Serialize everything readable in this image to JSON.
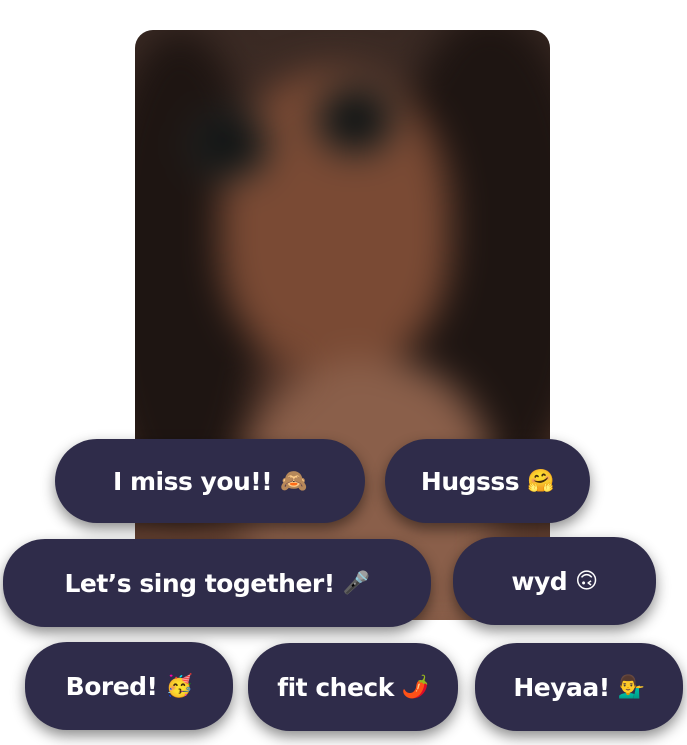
{
  "background_image": {
    "description": "blurred portrait photo of a person with dark hair and round sunglasses"
  },
  "chips": [
    {
      "label": "I miss you!!",
      "emoji": "🙈",
      "emoji_name": "see-no-evil-monkey-icon"
    },
    {
      "label": "Hugsss",
      "emoji": "🤗",
      "emoji_name": "hugging-face-icon"
    },
    {
      "label": "Let’s sing together!",
      "emoji": "🎤",
      "emoji_name": "microphone-icon"
    },
    {
      "label": "wyd",
      "emoji": "🙃",
      "emoji_name": "upside-down-face-icon"
    },
    {
      "label": "Bored!",
      "emoji": "🥳",
      "emoji_name": "partying-face-icon"
    },
    {
      "label": "fit check",
      "emoji": "🌶️",
      "emoji_name": "hot-pepper-icon"
    },
    {
      "label": "Heyaa!",
      "emoji": "💁‍♂️",
      "emoji_name": "person-tipping-hand-icon"
    }
  ],
  "colors": {
    "chip_background": "#2f2c4a",
    "chip_text": "#ffffff"
  }
}
